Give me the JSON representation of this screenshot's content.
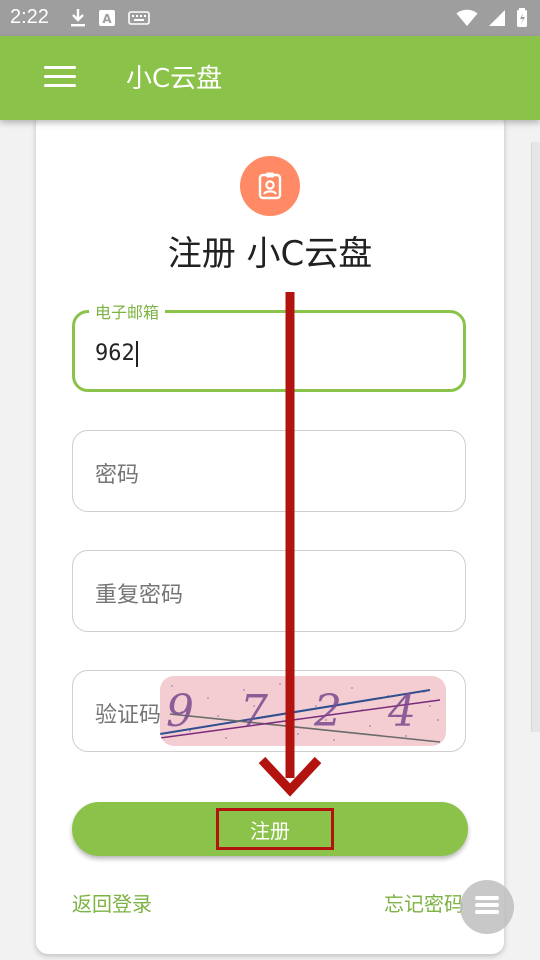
{
  "status_bar": {
    "time": "2:22",
    "left_icons": [
      "download-icon",
      "a-box-icon",
      "keyboard-icon"
    ],
    "right_icons": [
      "wifi-icon",
      "signal-icon",
      "battery-icon"
    ]
  },
  "appbar": {
    "title": "小C云盘",
    "menu_icon": "hamburger-menu-icon"
  },
  "form": {
    "header_icon": "contact-badge-icon",
    "title": "注册 小C云盘",
    "email": {
      "label": "电子邮箱",
      "value": "962"
    },
    "password": {
      "placeholder": "密码"
    },
    "repeat_password": {
      "placeholder": "重复密码"
    },
    "captcha": {
      "placeholder": "验证码",
      "image_text": "9724"
    },
    "register_button": "注册",
    "back_to_login": "返回登录",
    "forgot_password": "忘记密码"
  },
  "floating_button": {
    "icon": "menu-lines-icon"
  },
  "colors": {
    "accent": "#8bc34a",
    "accent_text": "#7cb342",
    "avatar_bg": "#ff8a65",
    "annotation": "#b3130f",
    "status_bar": "#9e9e9e"
  }
}
